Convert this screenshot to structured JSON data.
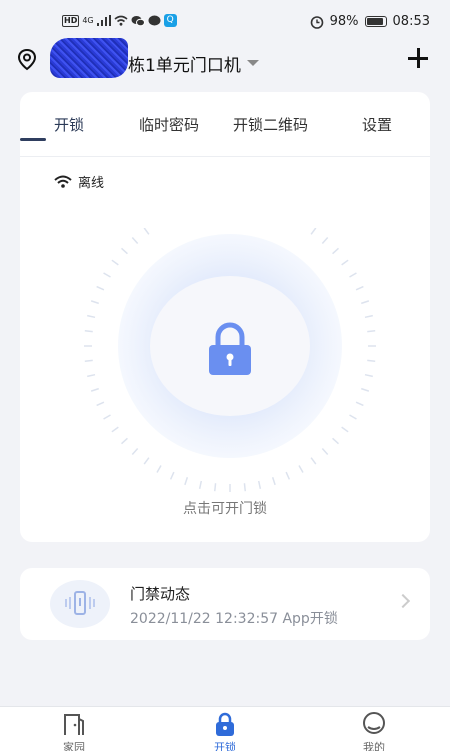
{
  "status_bar": {
    "left_badges": [
      "HD",
      "4G",
      "Q"
    ],
    "battery": "98%",
    "time": "08:53"
  },
  "header": {
    "device_name": "栋1单元门口机"
  },
  "tabs": [
    {
      "label": "开锁",
      "active": true
    },
    {
      "label": "临时密码",
      "active": false
    },
    {
      "label": "开锁二维码",
      "active": false
    },
    {
      "label": "设置",
      "active": false
    }
  ],
  "network": {
    "status": "离线",
    "icon": "wifi-icon"
  },
  "unlock": {
    "icon": "lock-icon",
    "hint": "点击可开门锁"
  },
  "activity": {
    "title": "门禁动态",
    "last_event": "2022/11/22 12:32:57 App开锁"
  },
  "bottom_nav": [
    {
      "label": "家园",
      "icon": "home-door-icon",
      "active": false
    },
    {
      "label": "开锁",
      "icon": "lock-icon",
      "active": true
    },
    {
      "label": "我的",
      "icon": "profile-icon",
      "active": false
    }
  ],
  "colors": {
    "accent": "#2f6bd9",
    "tab_indicator": "#2f3e5f",
    "lock": "#6a8ff0",
    "background": "#f2f3f7"
  }
}
